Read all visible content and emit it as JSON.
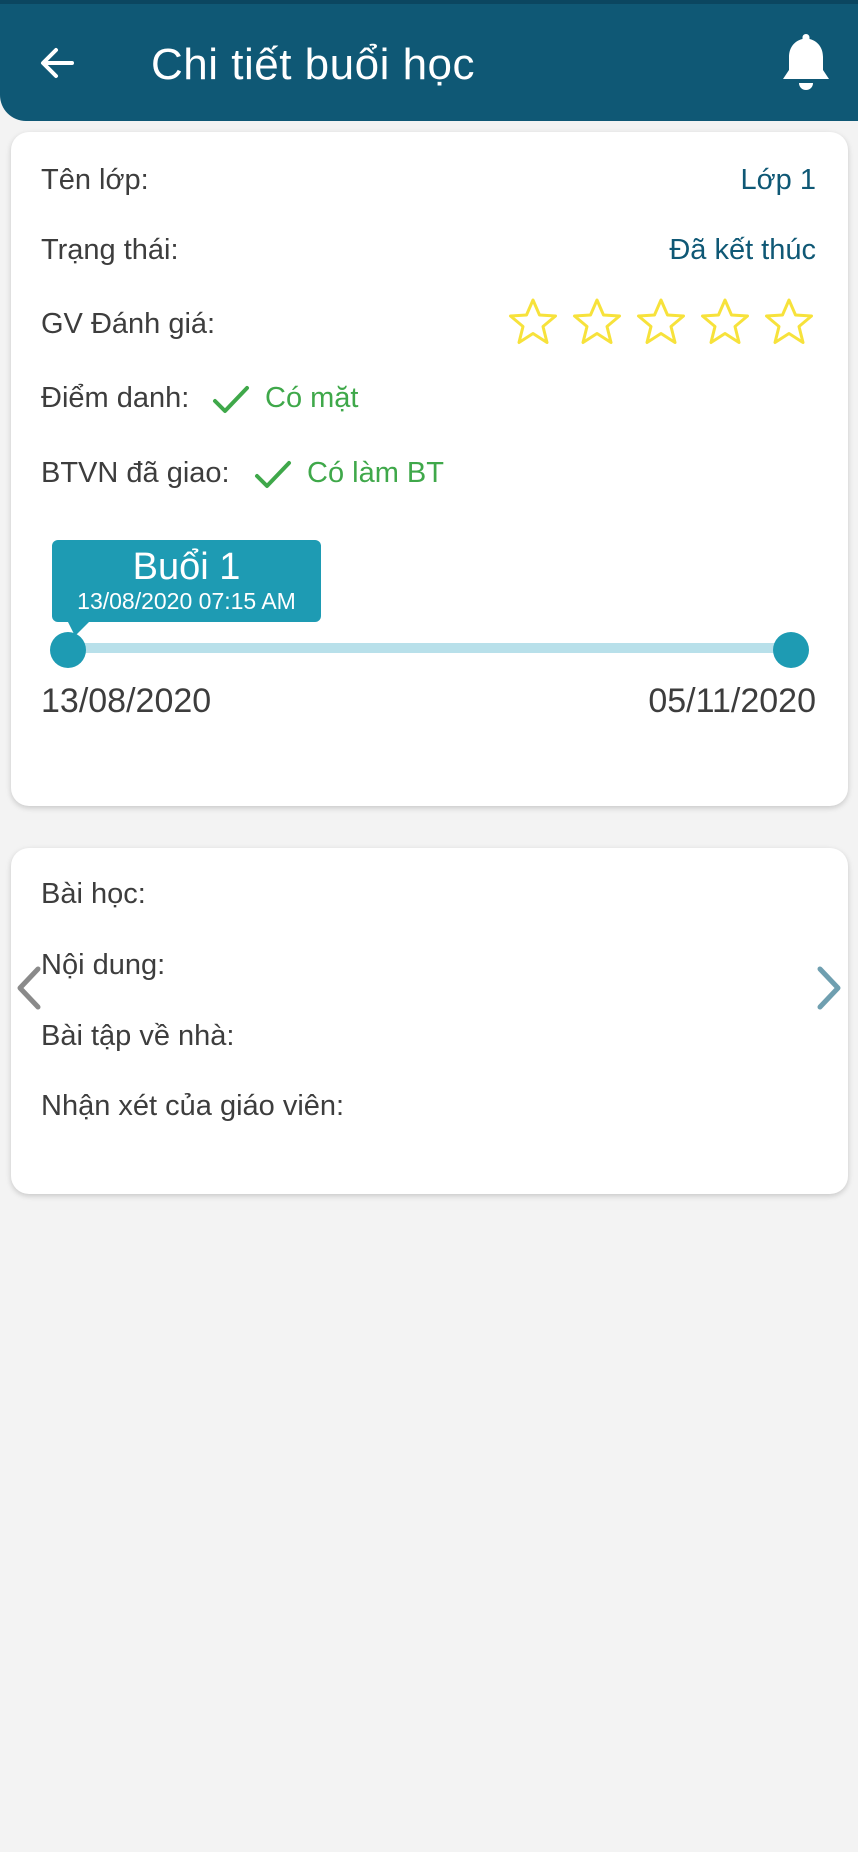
{
  "header": {
    "title": "Chi tiết buổi học",
    "back_icon": "arrow-left-icon",
    "notification_icon": "bell-icon",
    "background_color": "#0f5875"
  },
  "info": {
    "class_label": "Tên lớp:",
    "class_value": "Lớp 1",
    "status_label": "Trạng thái:",
    "status_value": "Đã kết thúc",
    "rating_label": "GV Đánh giá:",
    "rating_value": 0,
    "rating_max": 5,
    "attendance_label": "Điểm danh:",
    "attendance_value": "Có mặt",
    "homework_label": "BTVN đã giao:",
    "homework_value": "Có làm BT",
    "accent_color": "#0f5875",
    "success_color": "#3fa84a",
    "star_color": "#f7e23b"
  },
  "session_slider": {
    "tooltip_title": "Buổi 1",
    "tooltip_datetime": "13/08/2020 07:15 AM",
    "start_date": "13/08/2020",
    "end_date": "05/11/2020",
    "position": 0,
    "color": "#1e9bb3"
  },
  "lesson": {
    "lesson_label": "Bài học:",
    "content_label": "Nội dung:",
    "homework_label": "Bài tập về nhà:",
    "teacher_comment_label": "Nhận xét của giáo viên:",
    "prev_icon": "chevron-left-icon",
    "next_icon": "chevron-right-icon"
  }
}
